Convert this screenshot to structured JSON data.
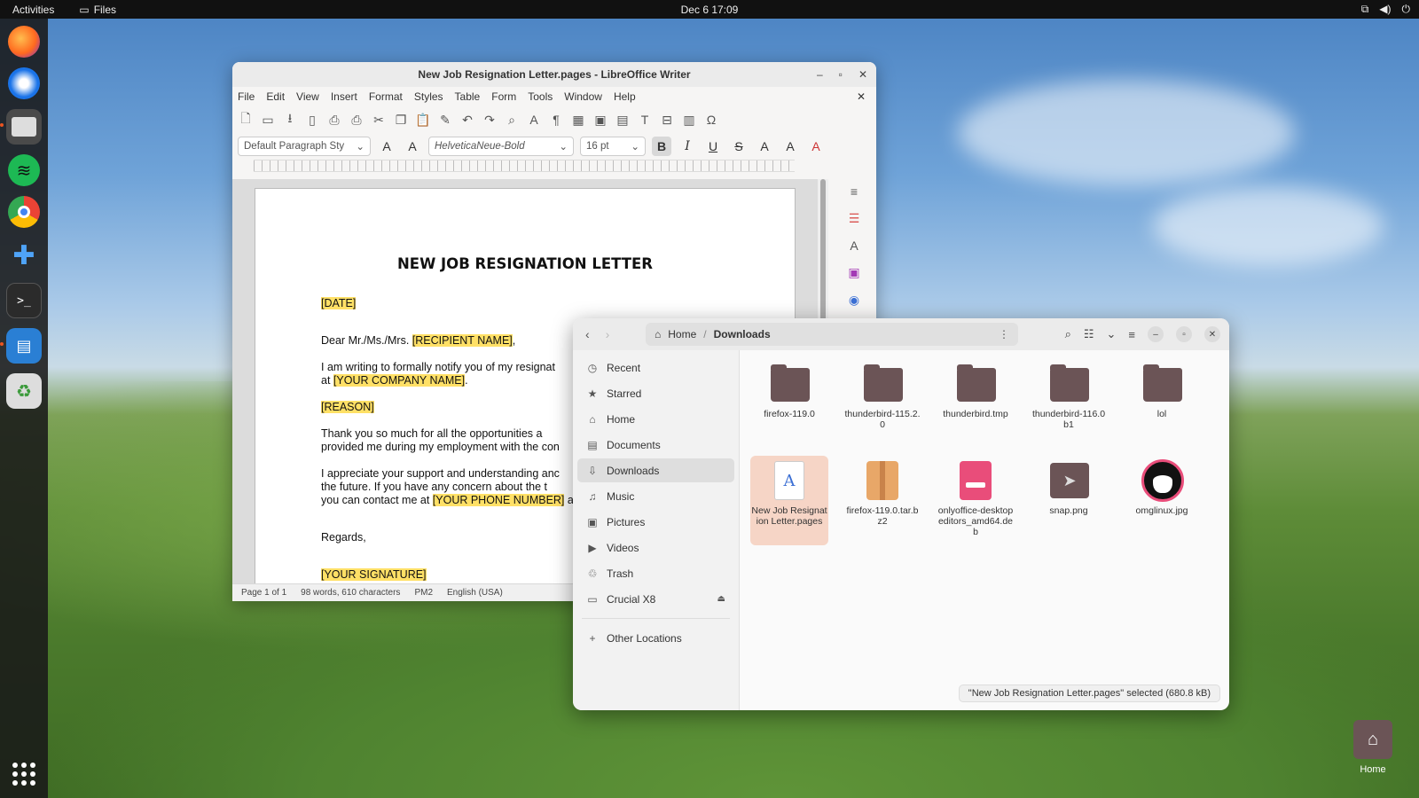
{
  "topbar": {
    "activities": "Activities",
    "app_name": "Files",
    "clock": "Dec 6  17:09"
  },
  "dock": {
    "apps": [
      "firefox-icon",
      "thunderbird-icon",
      "files-icon",
      "spotify-icon",
      "chrome-icon",
      "extensions-icon",
      "terminal-icon",
      "writer-icon",
      "trash-icon"
    ]
  },
  "writer": {
    "title": "New Job Resignation Letter.pages - LibreOffice Writer",
    "menu": [
      "File",
      "Edit",
      "View",
      "Insert",
      "Format",
      "Styles",
      "Table",
      "Form",
      "Tools",
      "Window",
      "Help"
    ],
    "paragraph_style": "Default Paragraph Sty",
    "font_name": "HelveticaNeue-Bold",
    "font_size": "16 pt",
    "doc": {
      "heading": "NEW JOB RESIGNATION LETTER",
      "date": "[DATE]",
      "dear": "Dear Mr./Ms./Mrs.",
      "recipient": "[RECIPIENT NAME]",
      "p1a": "I am writing to formally notify you of my resignat",
      "p1b_pre": "at",
      "company": "[YOUR COMPANY NAME]",
      "reason": "[REASON]",
      "p2a": "Thank you so much for all the opportunities a",
      "p2b": "provided me during my employment with the con",
      "p3a": "I appreciate your support and understanding anc",
      "p3b": "the future. If you have any concern about the t",
      "p3c_pre": "you can contact me at",
      "phone": "[YOUR PHONE NUMBER]",
      "p3c_post": "ar",
      "regards": "Regards,",
      "signature": "[YOUR SIGNATURE]"
    },
    "status": {
      "page": "Page 1 of 1",
      "words": "98 words, 610 characters",
      "style": "PM2",
      "language": "English (USA)"
    }
  },
  "files": {
    "path_home": "Home",
    "path_current": "Downloads",
    "places": [
      {
        "icon": "clock-icon",
        "glyph": "◷",
        "label": "Recent"
      },
      {
        "icon": "star-icon",
        "glyph": "★",
        "label": "Starred"
      },
      {
        "icon": "home-icon",
        "glyph": "⌂",
        "label": "Home"
      },
      {
        "icon": "documents-icon",
        "glyph": "▤",
        "label": "Documents"
      },
      {
        "icon": "download-icon",
        "glyph": "⇩",
        "label": "Downloads"
      },
      {
        "icon": "music-icon",
        "glyph": "♫",
        "label": "Music"
      },
      {
        "icon": "pictures-icon",
        "glyph": "▣",
        "label": "Pictures"
      },
      {
        "icon": "videos-icon",
        "glyph": "▶",
        "label": "Videos"
      },
      {
        "icon": "trash-icon",
        "glyph": "♲",
        "label": "Trash"
      },
      {
        "icon": "drive-icon",
        "glyph": "▭",
        "label": "Crucial X8"
      }
    ],
    "other_locations": "Other Locations",
    "items": [
      {
        "label": "firefox-119.0",
        "kind": "folder"
      },
      {
        "label": "thunderbird-115.2.0",
        "kind": "folder"
      },
      {
        "label": "thunderbird.tmp",
        "kind": "folder"
      },
      {
        "label": "thunderbird-116.0b1",
        "kind": "folder"
      },
      {
        "label": "lol",
        "kind": "folder"
      },
      {
        "label": "New Job Resignation Letter.pages",
        "kind": "document"
      },
      {
        "label": "firefox-119.0.tar.bz2",
        "kind": "archive"
      },
      {
        "label": "onlyoffice-desktopeditors_amd64.deb",
        "kind": "package"
      },
      {
        "label": "snap.png",
        "kind": "image"
      },
      {
        "label": "omglinux.jpg",
        "kind": "image"
      }
    ],
    "status": "\"New Job Resignation Letter.pages\" selected  (680.8 kB)"
  },
  "desktop": {
    "home_label": "Home"
  },
  "colors": {
    "accent": "#e95420",
    "highlight": "#ffe066",
    "folder": "#6b5456",
    "selection": "#f6d5c6"
  }
}
